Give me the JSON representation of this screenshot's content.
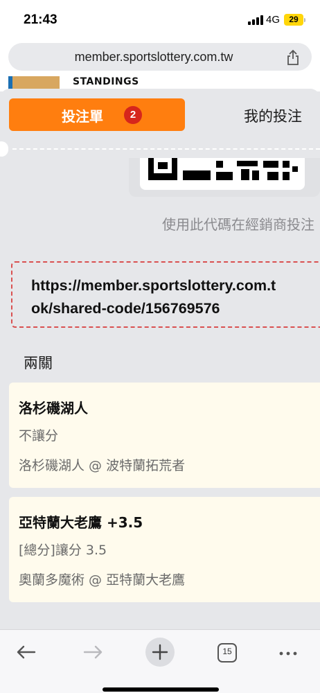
{
  "status_bar": {
    "time": "21:43",
    "network": "4G",
    "battery": "29"
  },
  "browser": {
    "url": "member.sportslottery.com.tw",
    "tab_count": "15"
  },
  "background_page": {
    "heading": "STANDINGS"
  },
  "bet_sheet": {
    "tabs": {
      "active_label": "投注單",
      "active_badge": "2",
      "other_label": "我的投注"
    },
    "qr_hint": "使用此代碼在經銷商投注",
    "share_link": "https://member.sportslottery.com.tw/ok/shared-code/156769576",
    "share_link_display": "https://member.sportslottery.com.t\nok/shared-code/156769576",
    "parlay_title": "兩關",
    "selections": [
      {
        "team": "洛杉磯湖人",
        "bet_type": "不讓分",
        "match": "洛杉磯湖人 @ 波特蘭拓荒者"
      },
      {
        "team": "亞特蘭大老鷹 +3.5",
        "bet_type": "[總分]讓分 3.5",
        "match": "奧蘭多魔術 @ 亞特蘭大老鷹"
      }
    ]
  },
  "colors": {
    "accent": "#ff7e0f",
    "badge": "#d6261c",
    "card_bg": "#fffbed",
    "dashed_border": "#d95050"
  }
}
